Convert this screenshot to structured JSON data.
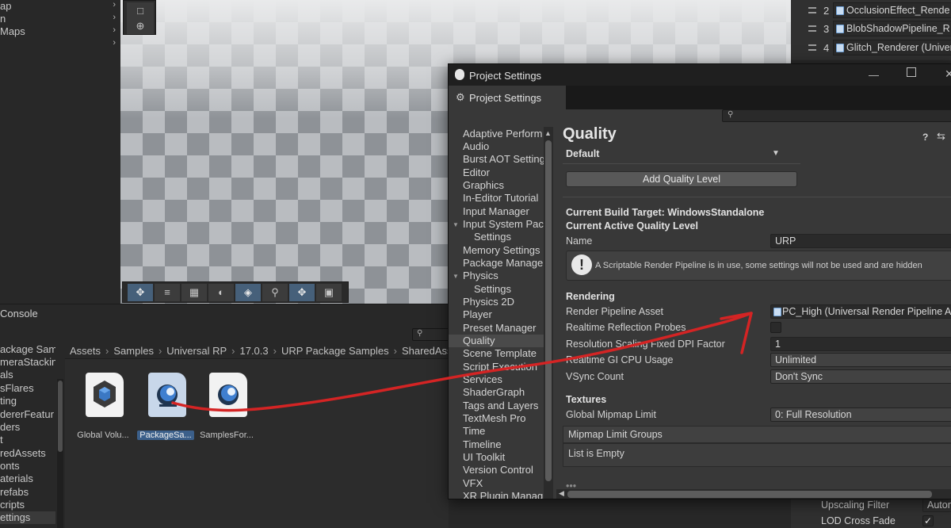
{
  "hierarchy": {
    "rows": [
      {
        "label": "ap"
      },
      {
        "label": "n"
      },
      {
        "label": "Maps"
      }
    ]
  },
  "renderer_list": [
    {
      "index": "2",
      "name": "OcclusionEffect_Rende"
    },
    {
      "index": "3",
      "name": "BlobShadowPipeline_R"
    },
    {
      "index": "4",
      "name": "Glitch_Renderer (Univer"
    }
  ],
  "console": {
    "tab_label": "Console"
  },
  "folder_tree": [
    "ackage Sam",
    "meraStacking",
    "als",
    "sFlares",
    "ting",
    "dererFeatur",
    "ders",
    "t",
    "redAssets",
    "onts",
    "aterials",
    "refabs",
    "cripts",
    "ettings",
    "..."
  ],
  "breadcrumb": [
    "Assets",
    "Samples",
    "Universal RP",
    "17.0.3",
    "URP Package Samples",
    "SharedAss"
  ],
  "assets": [
    {
      "label": "Global Volu...",
      "icon": "volume-profile-icon"
    },
    {
      "label": "PackageSa...",
      "icon": "urp-asset-icon",
      "selected": true
    },
    {
      "label": "SamplesFor...",
      "icon": "urp-asset-icon"
    }
  ],
  "right_bottom": {
    "upscaling_label": "Upscaling Filter",
    "upscaling_value": "Autom",
    "lod_label": "LOD Cross Fade"
  },
  "project_settings": {
    "window_title": "Project Settings",
    "tab_label": "Project Settings",
    "nav": [
      {
        "label": "Adaptive Perform"
      },
      {
        "label": "Audio"
      },
      {
        "label": "Burst AOT Setting"
      },
      {
        "label": "Editor"
      },
      {
        "label": "Graphics"
      },
      {
        "label": "In-Editor Tutorial"
      },
      {
        "label": "Input Manager"
      },
      {
        "label": "Input System Pac",
        "foldout": true
      },
      {
        "label": "Settings",
        "child": true
      },
      {
        "label": "Memory Settings"
      },
      {
        "label": "Package Manage"
      },
      {
        "label": "Physics",
        "foldout": true
      },
      {
        "label": "Settings",
        "child": true
      },
      {
        "label": "Physics 2D"
      },
      {
        "label": "Player"
      },
      {
        "label": "Preset Manager"
      },
      {
        "label": "Quality",
        "selected": true
      },
      {
        "label": "Scene Template"
      },
      {
        "label": "Script Execution"
      },
      {
        "label": "Services"
      },
      {
        "label": "ShaderGraph"
      },
      {
        "label": "Tags and Layers"
      },
      {
        "label": "TextMesh Pro"
      },
      {
        "label": "Time"
      },
      {
        "label": "Timeline"
      },
      {
        "label": "UI Toolkit"
      },
      {
        "label": "Version Control"
      },
      {
        "label": "VFX"
      },
      {
        "label": "XR Plugin Manag"
      }
    ],
    "quality": {
      "title": "Quality",
      "default_label": "Default",
      "add_level_button": "Add Quality Level",
      "build_target": "Current Build Target: WindowsStandalone",
      "active_level_header": "Current Active Quality Level",
      "name_label": "Name",
      "name_value": "URP",
      "srp_notice": "A Scriptable Render Pipeline is in use, some settings will not be used and are hidden",
      "rendering_header": "Rendering",
      "render_pipeline_label": "Render Pipeline Asset",
      "render_pipeline_value": "PC_High (Universal Render Pipeline A",
      "realtime_reflection_label": "Realtime Reflection Probes",
      "resolution_scaling_label": "Resolution Scaling Fixed DPI Factor",
      "resolution_scaling_value": "1",
      "realtime_gi_label": "Realtime GI CPU Usage",
      "realtime_gi_value": "Unlimited",
      "vsync_label": "VSync Count",
      "vsync_value": "Don't Sync",
      "textures_header": "Textures",
      "mipmap_limit_label": "Global Mipmap Limit",
      "mipmap_limit_value": "0: Full Resolution",
      "mipmap_groups_header": "Mipmap Limit Groups",
      "list_empty": "List is Empty"
    }
  },
  "annotation_color": "#d42424"
}
